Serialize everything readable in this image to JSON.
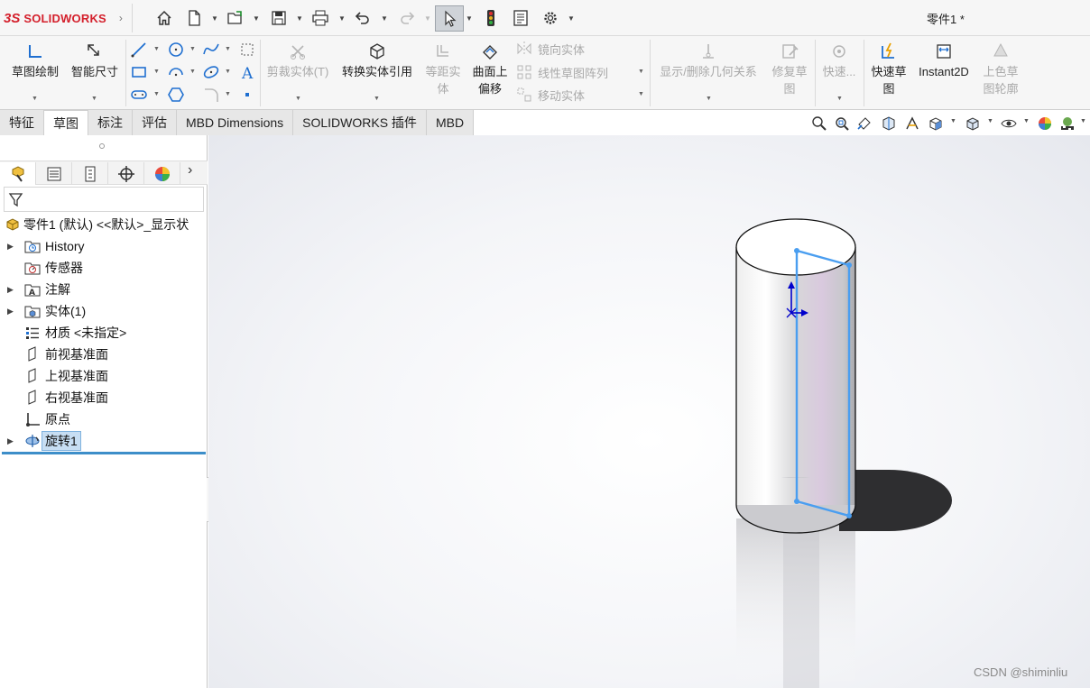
{
  "app": {
    "logo_ds": "3S",
    "logo_brand": "SOLIDWORKS",
    "document_title": "零件1 *"
  },
  "quick_access": [
    {
      "name": "home-icon"
    },
    {
      "name": "new-file-icon"
    },
    {
      "name": "open-file-icon"
    },
    {
      "name": "save-icon"
    },
    {
      "name": "print-icon"
    },
    {
      "name": "undo-icon"
    },
    {
      "name": "redo-icon"
    },
    {
      "name": "select-cursor-icon"
    },
    {
      "name": "rebuild-traffic-light-icon"
    },
    {
      "name": "file-properties-icon"
    },
    {
      "name": "options-gear-icon"
    }
  ],
  "ribbon": {
    "sketch": "草图绘制",
    "smart_dimension": "智能尺寸",
    "trim_entities": "剪裁实体(T)",
    "convert_entities": "转换实体引用",
    "offset_entities_line1": "等距实",
    "offset_entities_line2": "体",
    "offset_on_surface_line1": "曲面上",
    "offset_on_surface_line2": "偏移",
    "mirror_entities": "镜向实体",
    "linear_pattern": "线性草图阵列",
    "move_entities": "移动实体",
    "display_delete_relations": "显示/删除几何关系",
    "repair_sketch_line1": "修复草",
    "repair_sketch_line2": "图",
    "quick_snaps": "快速...",
    "rapid_sketch_line1": "快速草",
    "rapid_sketch_line2": "图",
    "instant2d": "Instant2D",
    "shaded_sketch_line1": "上色草",
    "shaded_sketch_line2": "图轮廓"
  },
  "tabs": [
    {
      "label": "特征",
      "active": false
    },
    {
      "label": "草图",
      "active": true
    },
    {
      "label": "标注",
      "active": false
    },
    {
      "label": "评估",
      "active": false
    },
    {
      "label": "MBD Dimensions",
      "active": false
    },
    {
      "label": "SOLIDWORKS 插件",
      "active": false
    },
    {
      "label": "MBD",
      "active": false
    }
  ],
  "feature_tree": {
    "root": "零件1 (默认) <<默认>_显示状",
    "items": [
      {
        "label": "History",
        "icon": "history-folder-icon",
        "expandable": true
      },
      {
        "label": "传感器",
        "icon": "sensors-icon",
        "expandable": false
      },
      {
        "label": "注解",
        "icon": "annotations-icon",
        "expandable": true
      },
      {
        "label": "实体(1)",
        "icon": "solid-bodies-icon",
        "expandable": true
      },
      {
        "label": "材质 <未指定>",
        "icon": "material-icon",
        "expandable": false
      },
      {
        "label": "前视基准面",
        "icon": "plane-icon",
        "expandable": false
      },
      {
        "label": "上视基准面",
        "icon": "plane-icon",
        "expandable": false
      },
      {
        "label": "右视基准面",
        "icon": "plane-icon",
        "expandable": false
      },
      {
        "label": "原点",
        "icon": "origin-icon",
        "expandable": false
      },
      {
        "label": "旋转1",
        "icon": "revolve-feature-icon",
        "expandable": true,
        "selected": true
      }
    ]
  },
  "watermark": "CSDN @shiminliu",
  "colors": {
    "brand_red": "#d4202c",
    "sketch_blue": "#4a9ef0",
    "selection_blue": "#c7def3"
  }
}
